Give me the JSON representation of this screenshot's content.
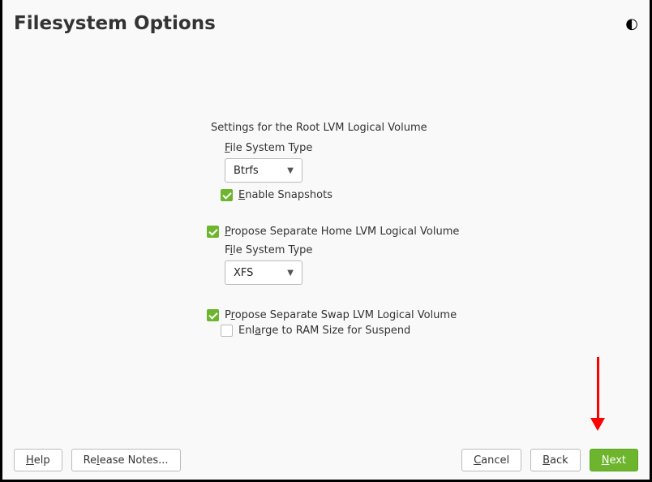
{
  "header": {
    "title": "Filesystem Options",
    "theme_icon": "◐"
  },
  "root": {
    "section_label": "Settings for the Root LVM Logical Volume",
    "fs_label_u": "F",
    "fs_label_rest": "ile System Type",
    "fs_value": "Btrfs",
    "snap_u": "E",
    "snap_rest": "nable Snapshots"
  },
  "home": {
    "prop_u": "P",
    "prop_rest": "ropose Separate Home LVM Logical Volume",
    "fs_label_pre": "F",
    "fs_label_u": "i",
    "fs_label_rest": "le System Type",
    "fs_value": "XFS"
  },
  "swap": {
    "prop_pre": "P",
    "prop_u": "r",
    "prop_rest": "opose Separate Swap LVM Logical Volume",
    "enl_pre": "Enl",
    "enl_u": "a",
    "enl_rest": "rge to RAM Size for Suspend"
  },
  "footer": {
    "help_u": "H",
    "help_rest": "elp",
    "release_pre": "Re",
    "release_u": "l",
    "release_rest": "ease Notes...",
    "cancel_u": "C",
    "cancel_rest": "ancel",
    "back_u": "B",
    "back_rest": "ack",
    "next_u": "N",
    "next_rest": "ext"
  }
}
